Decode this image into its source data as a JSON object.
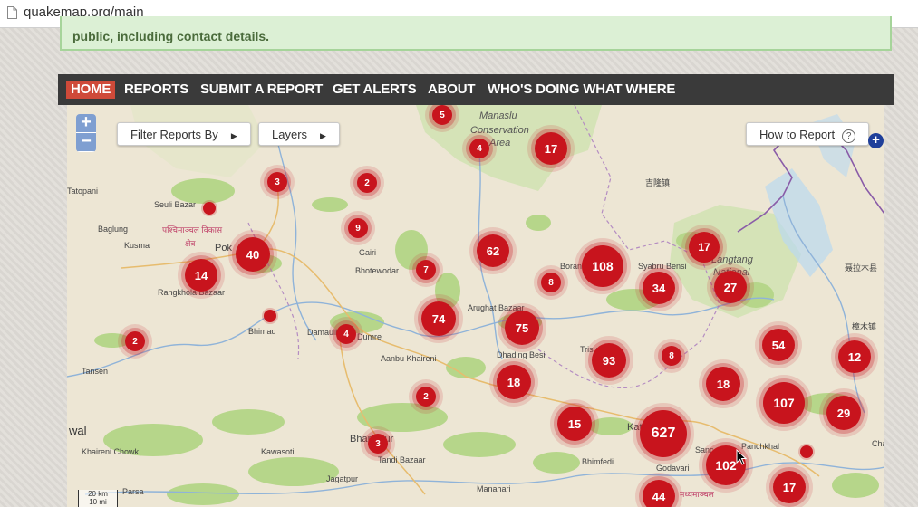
{
  "browser": {
    "url": "quakemap.org/main"
  },
  "notice": {
    "text": "public, including contact details."
  },
  "nav": {
    "items": [
      {
        "label": "HOME",
        "active": true
      },
      {
        "label": "REPORTS"
      },
      {
        "label": "SUBMIT A REPORT"
      },
      {
        "label": "GET ALERTS"
      },
      {
        "label": "ABOUT"
      },
      {
        "label": "WHO'S DOING WHAT WHERE"
      }
    ]
  },
  "map": {
    "zoom_in": "+",
    "zoom_out": "−",
    "filter_label": "Filter Reports By",
    "layers_label": "Layers",
    "how_to_report_label": "How to Report",
    "help_glyph": "?",
    "scale_km": "20 km",
    "scale_mi": "10 mi",
    "places": [
      "Manaslu",
      "Conservation",
      "Area",
      "Tatopani",
      "Seuli Bazar",
      "Baglung",
      "Kusma",
      "पश्चिमाञ्चल विकास",
      "क्षेत्र",
      "Pok",
      "Rangkhola Bazaar",
      "Bhimad",
      "Damauli",
      "Dumre",
      "Aanbu Khaireni",
      "Tansen",
      "Gairi",
      "Bhotewodar",
      "Arughat Bazaar",
      "Dhading Besi",
      "Boran",
      "Syabru Bensi",
      "Langtang",
      "National",
      "吉隆镇",
      "聂拉木县",
      "樟木镇",
      "Trisu",
      "Kawasoti",
      "Khaireni Chowk",
      "Bharatpur",
      "Tandi Bazaar",
      "Jagatpur",
      "Bhimfedi",
      "Godavari",
      "Panchkhal",
      "Kat",
      "Sanc",
      "Cha",
      "Parsa",
      "Manahari",
      "wal",
      "मध्यमाञ्चल"
    ],
    "clusters": [
      {
        "label": "5",
        "kind": "small"
      },
      {
        "label": "4",
        "kind": "small"
      },
      {
        "label": "17",
        "kind": "medium"
      },
      {
        "label": "3",
        "kind": "small"
      },
      {
        "label": "2",
        "kind": "small"
      },
      {
        "label": "9",
        "kind": "small"
      },
      {
        "label": "40",
        "kind": "medium"
      },
      {
        "label": "14",
        "kind": "medium"
      },
      {
        "label": "62",
        "kind": "medium"
      },
      {
        "label": "108",
        "kind": "large"
      },
      {
        "label": "17",
        "kind": "medium"
      },
      {
        "label": "7",
        "kind": "small"
      },
      {
        "label": "8",
        "kind": "small"
      },
      {
        "label": "34",
        "kind": "medium"
      },
      {
        "label": "27",
        "kind": "medium"
      },
      {
        "label": "74",
        "kind": "medium"
      },
      {
        "label": "75",
        "kind": "medium"
      },
      {
        "label": "4",
        "kind": "small"
      },
      {
        "label": "2",
        "kind": "small"
      },
      {
        "label": "93",
        "kind": "medium"
      },
      {
        "label": "8",
        "kind": "small"
      },
      {
        "label": "54",
        "kind": "medium"
      },
      {
        "label": "12",
        "kind": "medium"
      },
      {
        "label": "18",
        "kind": "medium"
      },
      {
        "label": "18",
        "kind": "medium"
      },
      {
        "label": "107",
        "kind": "large"
      },
      {
        "label": "29",
        "kind": "medium"
      },
      {
        "label": "2",
        "kind": "small"
      },
      {
        "label": "15",
        "kind": "medium"
      },
      {
        "label": "627",
        "kind": "xlarge"
      },
      {
        "label": "102",
        "kind": "large"
      },
      {
        "label": "3",
        "kind": "small"
      },
      {
        "label": "44",
        "kind": "medium"
      },
      {
        "label": "17",
        "kind": "medium"
      }
    ]
  },
  "colors": {
    "cluster": "#c8141d",
    "nav_bg": "#3a3a3a",
    "nav_active": "#cf4a39",
    "notice_bg": "#dcf0d5",
    "forest": "#b6d68a",
    "land": "#ede6d4",
    "protected_area": "#d2e2b4"
  }
}
